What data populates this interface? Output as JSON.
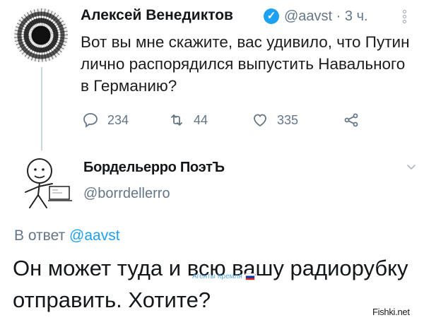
{
  "tweet1": {
    "author_name": "Алексей Венедиктов",
    "verified_icon": "verified-check-icon",
    "handle": "@aavst",
    "separator": "·",
    "time": "3 ч.",
    "text": "Вот вы мне скажите, вас удивило, что Путин лично распорядился выпустить Навального в Германию?",
    "actions": {
      "reply_count": "234",
      "retweet_count": "44",
      "like_count": "335"
    }
  },
  "tweet2": {
    "author_name": "Бордельерро ПоэтЪ",
    "handle": "@borrdellerro",
    "reply_to_prefix": "В ответ",
    "reply_to_handle": "@aavst",
    "text": "Он может туда и всю вашу радиорубку отправить. Хотите?"
  },
  "watermarks": {
    "overlay": "Агенты Кремля",
    "site": "Fishki.net"
  },
  "colors": {
    "accent": "#1da1f2",
    "muted": "#657786",
    "text": "#14171a"
  }
}
